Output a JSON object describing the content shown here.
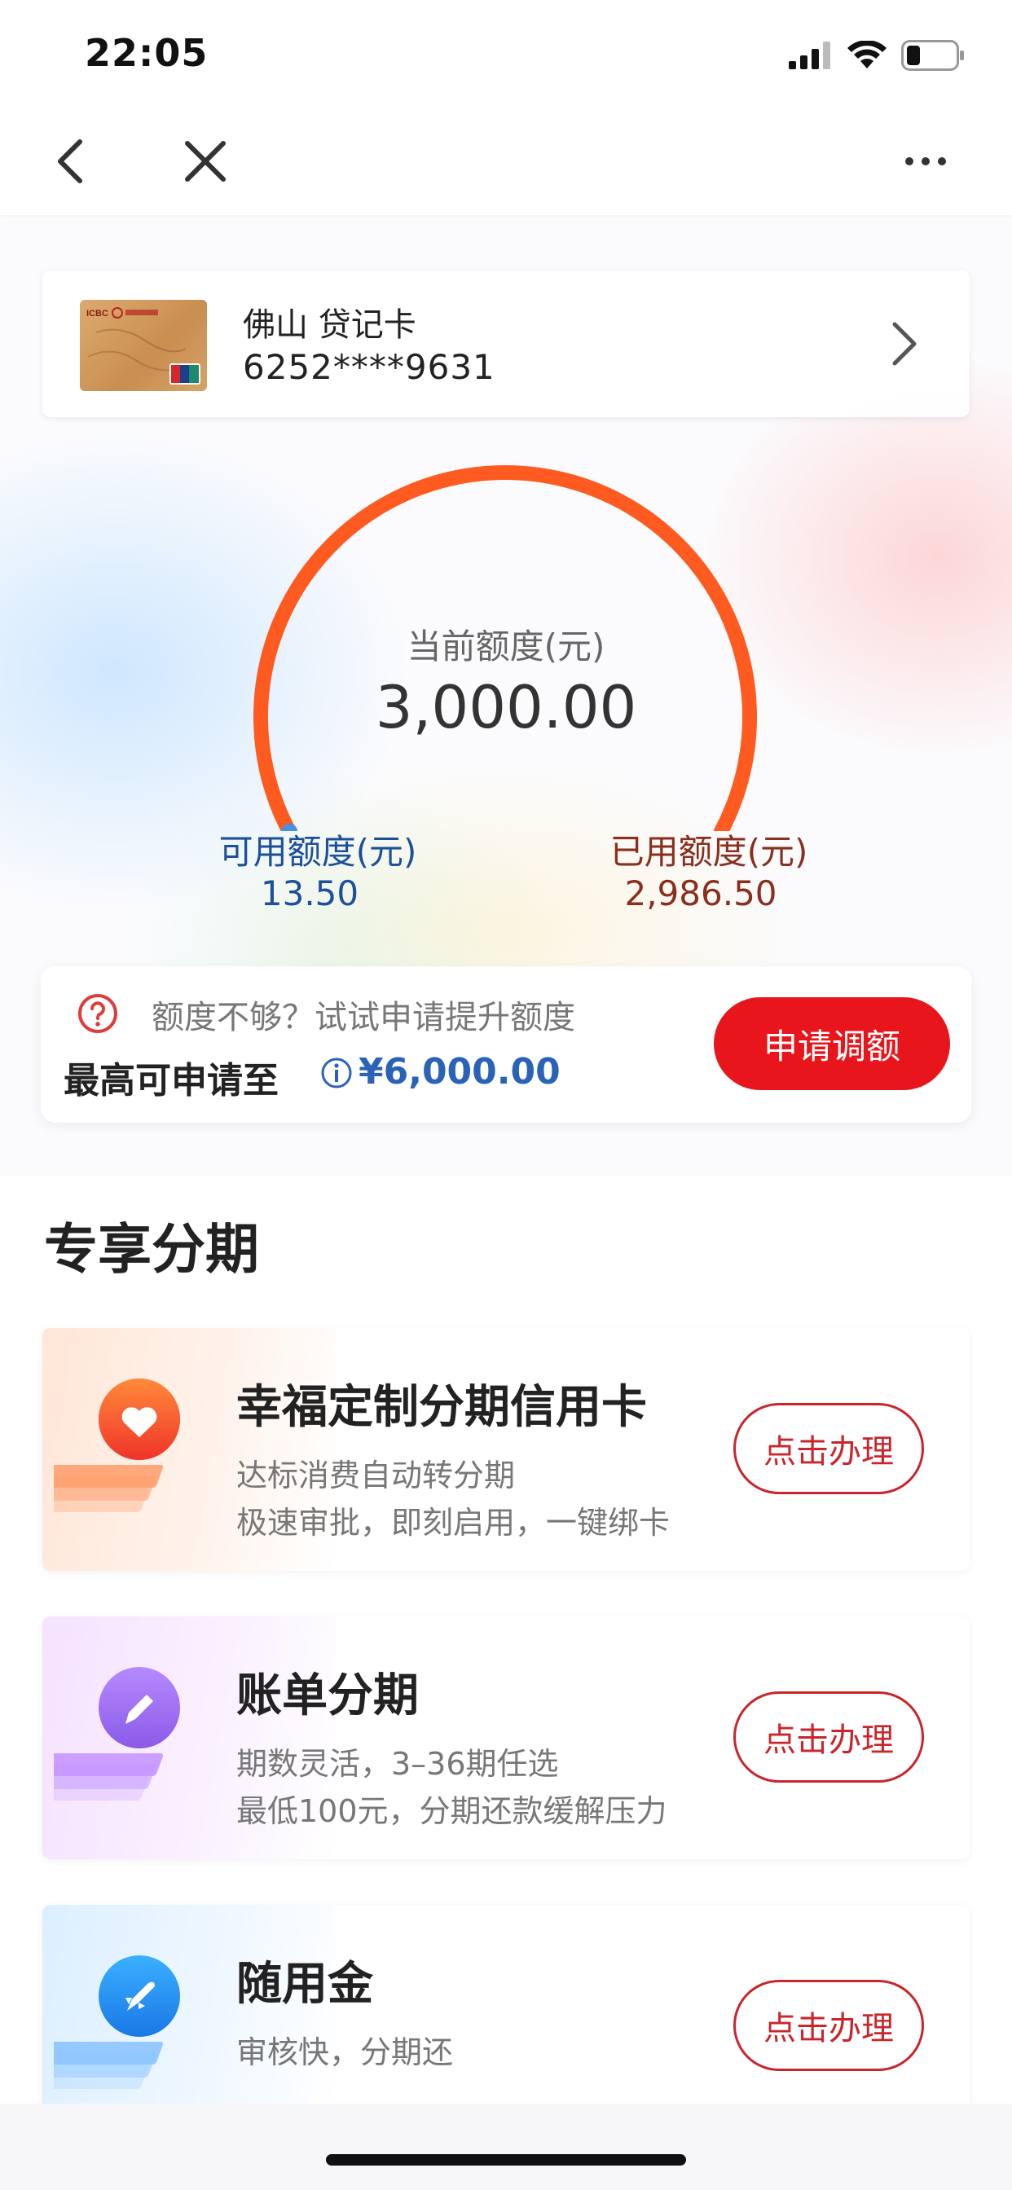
{
  "status": {
    "time": "22:05"
  },
  "card": {
    "title": "佛山 贷记卡",
    "number": "6252****9631"
  },
  "gauge": {
    "title": "当前额度(元)",
    "total": "3,000.00",
    "available_label": "可用额度(元)",
    "available_value": "13.50",
    "used_label": "已用额度(元)",
    "used_value": "2,986.50",
    "used_fraction": 0.9955
  },
  "quota": {
    "hint": "额度不够？试试申请提升额度",
    "max_label": "最高可申请至",
    "max_value": "¥6,000.00",
    "apply_label": "申请调额"
  },
  "section": {
    "title": "专享分期"
  },
  "products": [
    {
      "title": "幸福定制分期信用卡",
      "desc1": "达标消费自动转分期",
      "desc2": "极速审批，即刻启用，一键绑卡",
      "button": "点击办理",
      "icon": "heart-icon"
    },
    {
      "title": "账单分期",
      "desc1": "期数灵活，3–36期任选",
      "desc2": "最低100元，分期还款缓解压力",
      "button": "点击办理",
      "icon": "pencil-icon"
    },
    {
      "title": "随用金",
      "desc1": "审核快，分期还",
      "desc2": "",
      "button": "点击办理",
      "icon": "rocket-icon"
    }
  ],
  "colors": {
    "accent_red": "#e8161c",
    "gauge_orange": "#ff5a1f",
    "available_blue": "#1c4f9c",
    "used_brown": "#8a2e1e",
    "max_value_blue": "#2a62b8"
  }
}
